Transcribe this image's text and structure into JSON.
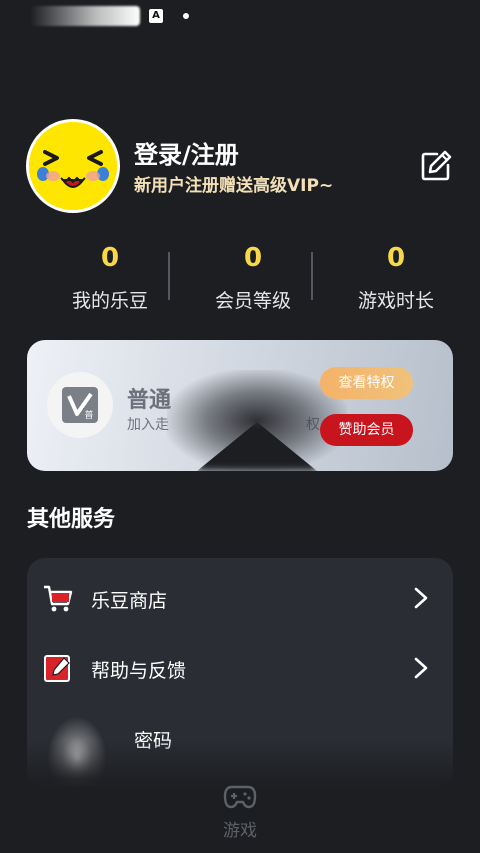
{
  "status_bar": {
    "badge": "A"
  },
  "profile": {
    "name": "登录/注册",
    "promo": "新用户注册赠送高级VIP~",
    "avatar_icon": "smiley-avatar",
    "edit_icon": "edit-icon"
  },
  "stats": [
    {
      "value": "0",
      "label": "我的乐豆"
    },
    {
      "value": "0",
      "label": "会员等级"
    },
    {
      "value": "0",
      "label": "游戏时长"
    }
  ],
  "vip_card": {
    "title": "普通",
    "subtitle": "加入走",
    "subtitle_tail": "权",
    "logo_icon": "normal-member-icon",
    "privilege_button": "查看特权",
    "sponsor_button": "赞助会员"
  },
  "services": {
    "title": "其他服务",
    "items": [
      {
        "label": "乐豆商店",
        "icon": "cart-icon"
      },
      {
        "label": "帮助与反馈",
        "icon": "feedback-edit-icon"
      },
      {
        "label": "密码",
        "icon": "lock-icon"
      }
    ]
  },
  "tabbar": {
    "items": [
      {
        "label": "游戏",
        "icon": "gamepad-icon"
      }
    ]
  },
  "colors": {
    "background": "#1c1e22",
    "stat_value": "#f8d848",
    "promo_text": "#f3e0b8",
    "sponsor_red": "#c8141c",
    "privilege_orange": "#f5b26a"
  }
}
